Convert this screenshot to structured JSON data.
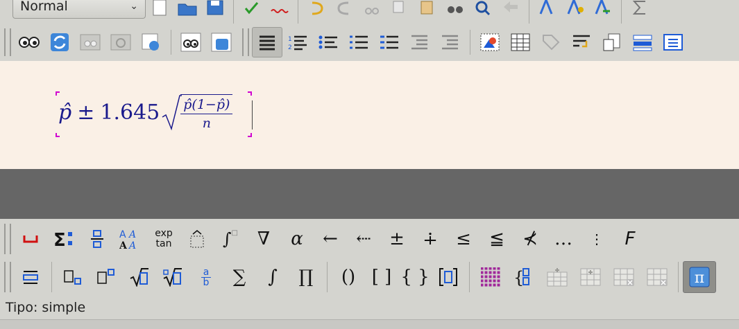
{
  "toolbar_standard": {
    "paragraph_style": "Normal"
  },
  "formula": {
    "phat": "p̂",
    "plus_minus": "±",
    "z": "1.645",
    "numerator": "p̂(1−p̂)",
    "denominator": "n"
  },
  "elements": {
    "exp_label": "exp",
    "tan_label": "tan",
    "frac_num": "a",
    "frac_den": "b",
    "symbols": {
      "nabla": "∇",
      "alpha": "α",
      "left_arrow": "←",
      "dotted_arrow": "⇠",
      "plus_minus": "±",
      "dot_plus": "∔",
      "le": "≤",
      "leqq": "≦",
      "nprec": "⊀",
      "ellipsis": "…",
      "vdots": "⋮",
      "f_italic": "F",
      "sum": "∑",
      "integral": "∫",
      "product": "∏",
      "parens": "()",
      "brackets": "[ ]",
      "braces": "{ }",
      "pi": "π"
    }
  },
  "status": {
    "text": "Tipo: simple"
  },
  "colors": {
    "formula_text": "#1a1a8c",
    "document_bg": "#faf0e6",
    "selection_marker": "#d000d0",
    "accent_blue": "#1e5bd6"
  }
}
